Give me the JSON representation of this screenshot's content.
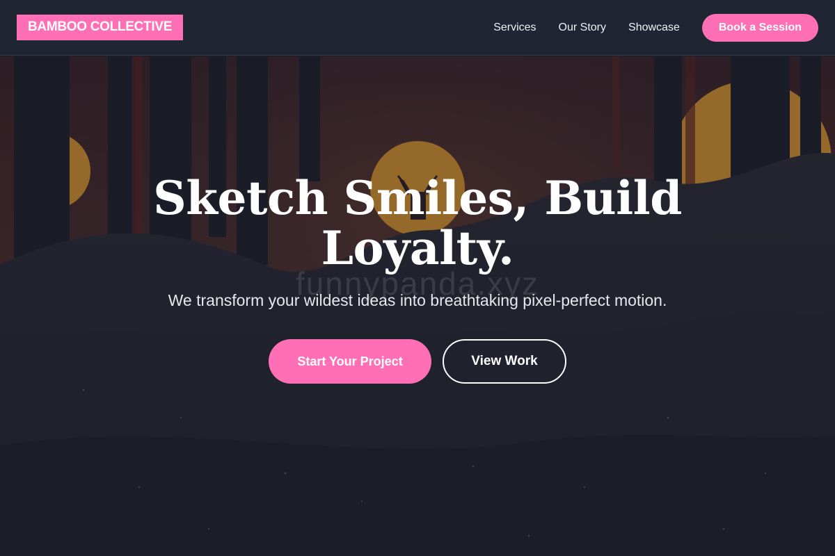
{
  "brand": {
    "name": "BAMBOO COLLECTIVE"
  },
  "nav": {
    "links": [
      "Services",
      "Our Story",
      "Showcase"
    ],
    "cta": "Book a Session"
  },
  "hero": {
    "headline": "Sketch Smiles, Build Loyalty.",
    "subheadline": "We transform your wildest ideas into breathtaking pixel-perfect motion.",
    "primary_cta": "Start Your Project",
    "secondary_cta": "View Work",
    "watermark": "funnypanda.xyz",
    "background_image": "forest-sunset-deer-illustration"
  },
  "colors": {
    "accent": "#ff6fb5",
    "header_bg": "#1f2533",
    "text_light": "#ffffff"
  }
}
